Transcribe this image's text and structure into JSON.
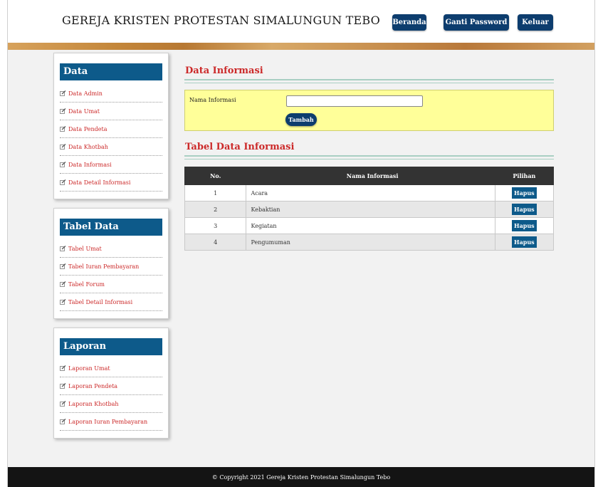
{
  "header": {
    "title": "GEREJA KRISTEN PROTESTAN SIMALUNGUN TEBO",
    "nav": {
      "beranda": "Beranda",
      "ganti_password": "Ganti Password",
      "keluar": "Keluar"
    }
  },
  "sidebar": {
    "data": {
      "title": "Data",
      "items": [
        {
          "label": "Data Admin"
        },
        {
          "label": "Data Umat"
        },
        {
          "label": "Data Pendeta"
        },
        {
          "label": "Data Khotbah"
        },
        {
          "label": "Data Informasi"
        },
        {
          "label": "Data Detail Informasi"
        }
      ]
    },
    "tabel": {
      "title": "Tabel Data",
      "items": [
        {
          "label": "Tabel Umat"
        },
        {
          "label": "Tabel Iuran Pembayaran"
        },
        {
          "label": "Tabel Forum"
        },
        {
          "label": "Tabel Detail Informasi"
        }
      ]
    },
    "laporan": {
      "title": "Laporan",
      "items": [
        {
          "label": "Laporan Umat"
        },
        {
          "label": "Laporan Pendeta"
        },
        {
          "label": "Laporan Khotbah"
        },
        {
          "label": "Laporan Iuran Pembayaran"
        }
      ]
    }
  },
  "main": {
    "form_title": "Data Informasi",
    "form": {
      "label": "Nama Informasi",
      "value": "",
      "submit": "Tambah"
    },
    "table_title": "Tabel Data Informasi",
    "table": {
      "columns": [
        "No.",
        "Nama Informasi",
        "Pilihan"
      ],
      "rows": [
        {
          "no": "1",
          "name": "Acara",
          "action": "Hapus"
        },
        {
          "no": "2",
          "name": "Kebaktian",
          "action": "Hapus"
        },
        {
          "no": "3",
          "name": "Kegiatan",
          "action": "Hapus"
        },
        {
          "no": "4",
          "name": "Pengumuman",
          "action": "Hapus"
        }
      ]
    }
  },
  "footer": {
    "text": "© Copyright 2021 Gereja Kristen Protestan Simalungun Tebo"
  },
  "colors": {
    "nav_button": "#0d3d6e",
    "sidebar_header": "#0d5a8a",
    "link_red": "#cc2a2a",
    "form_bg": "#ffff99",
    "table_header": "#333333",
    "footer_bg": "#141414"
  }
}
